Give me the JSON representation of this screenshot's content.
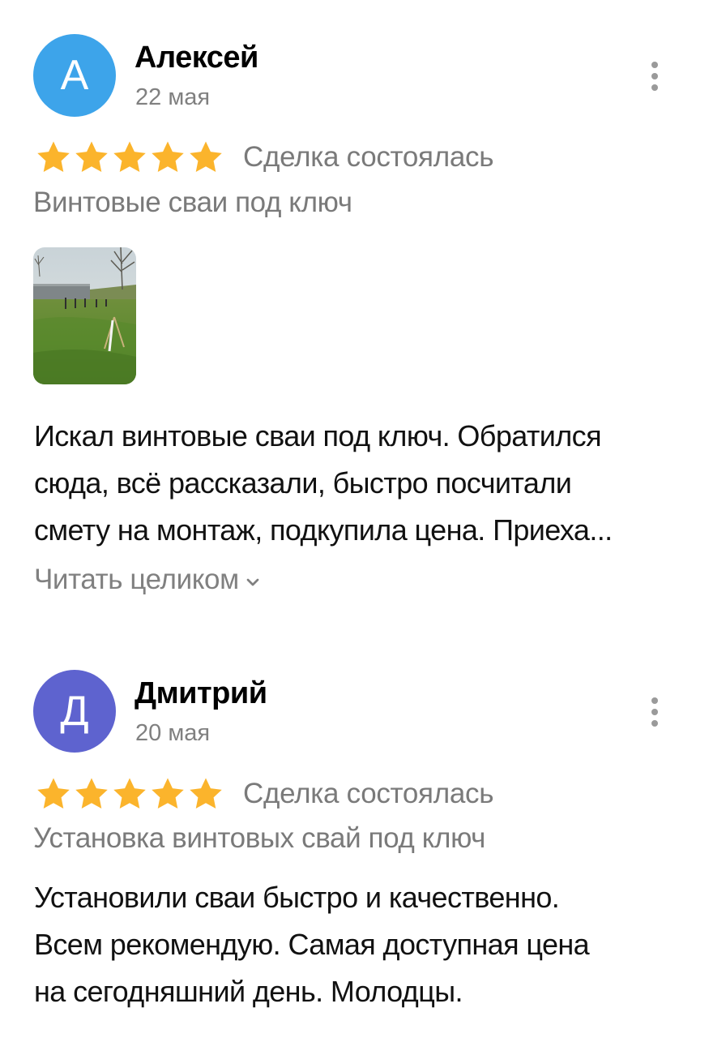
{
  "reviews": [
    {
      "avatar_letter": "А",
      "avatar_color": "#3da4ea",
      "author": "Алексей",
      "date": "22 мая",
      "rating": 5,
      "deal_status": "Сделка состоялась",
      "service": "Винтовые сваи под ключ",
      "photo_icon": "review-photo",
      "text_lines": [
        "Искал винтовые сваи под ключ. Обратился",
        "сюда, всё рассказали, быстро посчитали",
        "смету на монтаж, подкупила цена. Приеха..."
      ],
      "read_more_label": "Читать целиком"
    },
    {
      "avatar_letter": "Д",
      "avatar_color": "#5e63cf",
      "author": "Дмитрий",
      "date": "20 мая",
      "rating": 5,
      "deal_status": "Сделка состоялась",
      "service": "Установка винтовых свай под ключ",
      "text_lines": [
        "Установили сваи быстро и качественно.",
        "Всем рекомендую. Самая доступная цена",
        "на сегодняшний день. Молодцы."
      ]
    }
  ],
  "colors": {
    "star": "#fbb42c",
    "secondary_text": "#7a7a7a"
  }
}
